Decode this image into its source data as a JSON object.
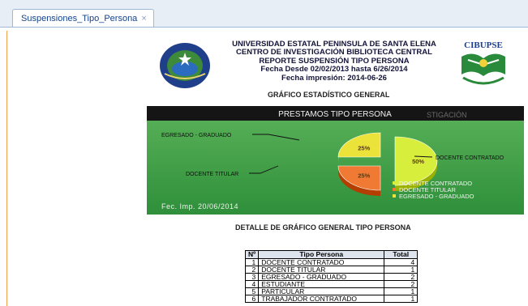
{
  "tab": {
    "label": "Suspensiones_Tipo_Persona",
    "close": "×"
  },
  "header": {
    "university": "UNIVERSIDAD ESTATAL PENINSULA DE SANTA ELENA",
    "center": "CENTRO DE INVESTIGACIÓN BIBLIOTECA CENTRAL",
    "report": "REPORTE SUSPENSIÓN TIPO PERSONA",
    "dates": "Fecha Desde 02/02/2013 hasta 6/26/2014",
    "print_date": "Fecha impresión: 2014-06-26",
    "right_logo_text": "CIBUPSE",
    "left_logo_text": "ESTATAL PENINSULA DE SANTA ELENA"
  },
  "general_title": "GRÁFICO ESTADÍSTICO GENERAL",
  "chart_data": {
    "type": "pie",
    "title": "PRESTAMOS TIPO PERSONA",
    "title_overlap": "STIGACIÓN",
    "footer": "Fec. Imp.  20/06/2014",
    "legend_position": "bottom-right",
    "slices": [
      {
        "label": "DOCENTE CONTRATADO",
        "value": 50,
        "value_label": "50%",
        "color": "#d8ee3c"
      },
      {
        "label": "DOCENTE TITULAR",
        "value": 25,
        "value_label": "25%",
        "color": "#f07a33"
      },
      {
        "label": "EGRESADO - GRADUADO",
        "value": 25,
        "value_label": "25%",
        "color": "#ece33a"
      }
    ]
  },
  "detail_title": "DETALLE DE GRÁFICO GENERAL TIPO PERSONA",
  "table": {
    "headers": [
      "Nº",
      "Tipo Persona",
      "Total"
    ],
    "rows": [
      [
        "1",
        "DOCENTE CONTRATADO",
        "4"
      ],
      [
        "2",
        "DOCENTE TITULAR",
        "1"
      ],
      [
        "3",
        "EGRESADO - GRADUADO",
        "2"
      ],
      [
        "4",
        "ESTUDIANTE",
        "2"
      ],
      [
        "5",
        "PARTICULAR",
        "1"
      ],
      [
        "6",
        "TRABAJADOR CONTRATADO",
        "1"
      ]
    ]
  }
}
